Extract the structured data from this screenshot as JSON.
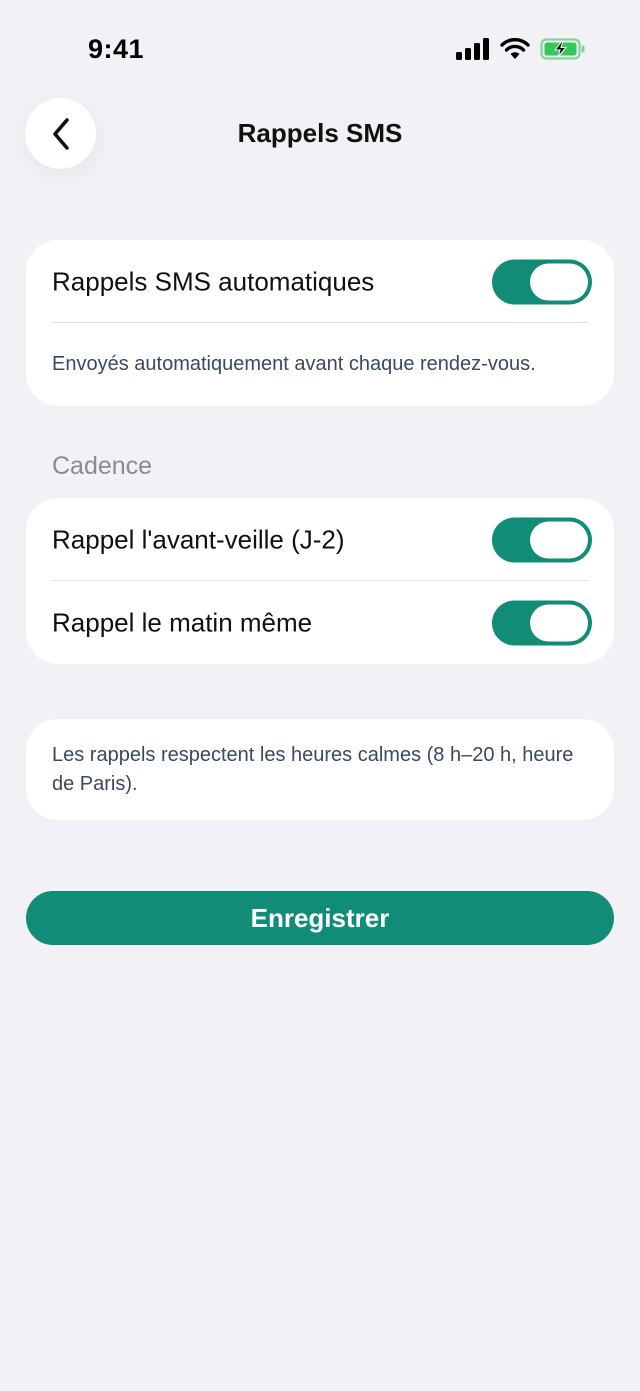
{
  "status_bar": {
    "time": "9:41",
    "signal_icon": "cellular-signal-icon",
    "wifi_icon": "wifi-icon",
    "battery_icon": "battery-charging-icon",
    "battery_color": "#34C759"
  },
  "nav": {
    "back_icon": "chevron-left-icon",
    "title": "Rappels SMS"
  },
  "auto_reminders": {
    "label": "Rappels SMS automatiques",
    "enabled": true,
    "helper": "Envoyés automatiquement avant chaque rendez-vous."
  },
  "cadence": {
    "section_label": "Cadence",
    "items": [
      {
        "label": "Rappel l'avant-veille (J-2)",
        "enabled": true
      },
      {
        "label": "Rappel le matin même",
        "enabled": true
      }
    ]
  },
  "info": {
    "text": "Les rappels respectent les heures calmes (8 h–20 h, heure de Paris)."
  },
  "actions": {
    "save_label": "Enregistrer"
  },
  "colors": {
    "accent": "#118C77",
    "background": "#F1F1F6",
    "card": "#FFFFFF",
    "helper_text": "#3A4A5E",
    "section_label": "#8A8A90"
  }
}
